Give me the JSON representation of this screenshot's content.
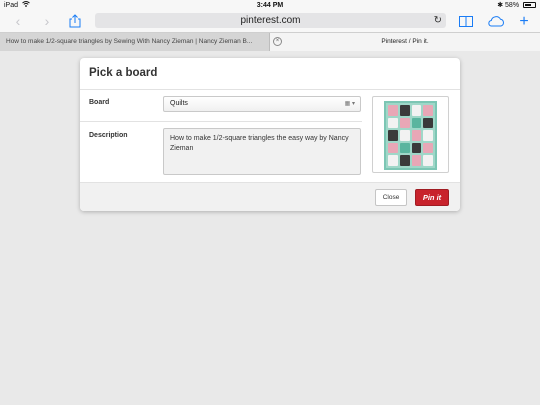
{
  "status": {
    "device": "iPad",
    "time": "3:44 PM",
    "battery": "58%"
  },
  "toolbar": {
    "url": "pinterest.com"
  },
  "tabs": [
    {
      "title": "How to make 1/2-square triangles by Sewing With Nancy Zieman | Nancy Zieman B..."
    },
    {
      "title": "Pinterest / Pin it."
    }
  ],
  "dialog": {
    "title": "Pick a board",
    "board_label": "Board",
    "board_value": "Quilts",
    "description_label": "Description",
    "description_value": "How to make 1/2-square triangles the easy way by Nancy Zieman",
    "close_label": "Close",
    "pin_label": "Pin it"
  },
  "colors": {
    "accent": "#1a7cf5",
    "pin_button": "#c8232c"
  },
  "icons": [
    "wifi-icon",
    "bluetooth-icon",
    "battery-icon",
    "back-icon",
    "forward-icon",
    "share-icon",
    "reload-icon",
    "bookmarks-icon",
    "icloud-icon",
    "new-tab-icon",
    "tab-close-icon",
    "dropdown-arrow-icon"
  ]
}
